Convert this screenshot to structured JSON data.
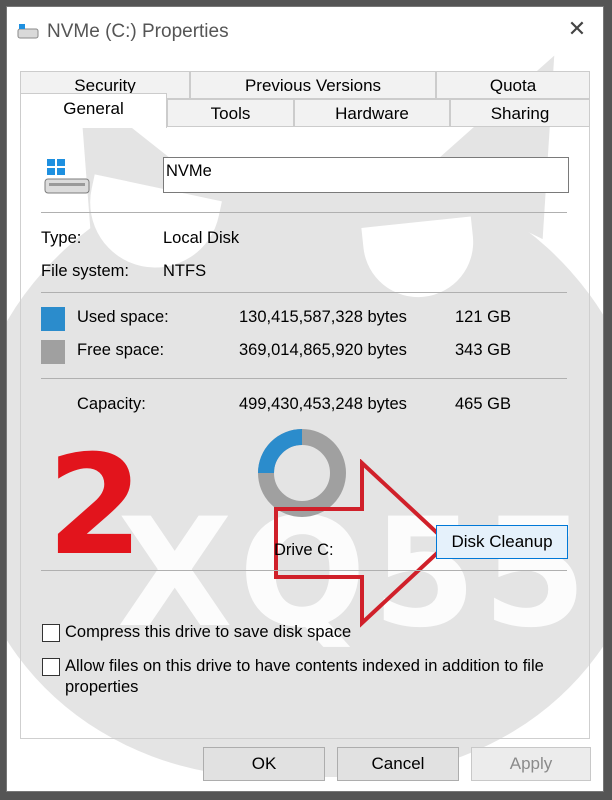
{
  "window": {
    "title": "NVMe (C:) Properties",
    "close_glyph": "✕"
  },
  "tabs": {
    "row1": [
      "Security",
      "Previous Versions",
      "Quota"
    ],
    "row2": [
      "General",
      "Tools",
      "Hardware",
      "Sharing"
    ],
    "active": "General"
  },
  "general": {
    "drive_name": "NVMe",
    "type_label": "Type:",
    "type_value": "Local Disk",
    "fs_label": "File system:",
    "fs_value": "NTFS",
    "used_label": "Used space:",
    "used_bytes": "130,415,587,328 bytes",
    "used_gb": "121 GB",
    "used_color": "#2b8ccc",
    "free_label": "Free space:",
    "free_bytes": "369,014,865,920 bytes",
    "free_gb": "343 GB",
    "free_color": "#a0a0a0",
    "capacity_label": "Capacity:",
    "capacity_bytes": "499,430,453,248 bytes",
    "capacity_gb": "465 GB",
    "drive_label": "Drive C:",
    "cleanup_button": "Disk Cleanup",
    "compress_label": "Compress this drive to save disk space",
    "index_label_line1": "Allow files on this drive to have contents indexed in addition to file",
    "index_label_line2": "properties"
  },
  "buttons": {
    "ok": "OK",
    "cancel": "Cancel",
    "apply": "Apply"
  },
  "overlay": {
    "step_number": "2",
    "watermark": "XQ55",
    "arrow_color": "#d0202a"
  }
}
